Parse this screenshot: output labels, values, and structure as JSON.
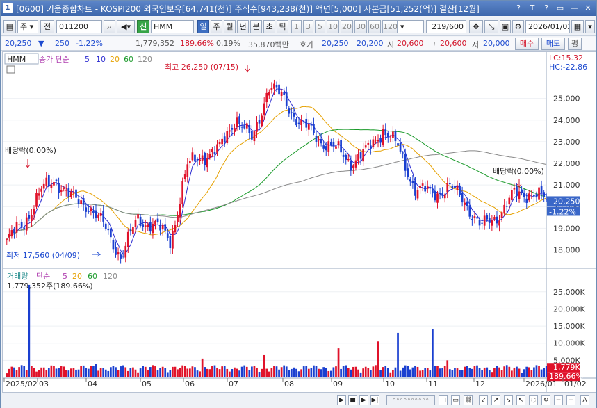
{
  "window": {
    "badge": "1",
    "title": "[0600] 키움종합차트 - KOSPI200 외국인보유[64,741(천)] 주식수[943,238(천)] 액면[5,000] 자본금[51,252(억)] 결산[12월]",
    "controls": [
      "?",
      "T",
      "?",
      "▭",
      "—",
      "✕"
    ]
  },
  "toolbar": {
    "period_select": "주",
    "prev_label": "전",
    "code": "011200",
    "sin_label": "신",
    "stock_name": "HMM",
    "periods": [
      "일",
      "주",
      "월",
      "년",
      "분",
      "초",
      "틱"
    ],
    "active_period": "일",
    "minutes": [
      "1",
      "3",
      "5",
      "10",
      "20",
      "30",
      "60",
      "120"
    ],
    "count": "219",
    "count_max": "/600",
    "date": "2026/01/02"
  },
  "quote": {
    "price": "20,250",
    "arrow": "▼",
    "change": "250",
    "change_pct": "-1.22%",
    "volume": "1,779,352",
    "volume_ratio": "189.66%",
    "turnover": "0.19%",
    "amount": "35,870백만",
    "hoga_label": "호가",
    "ask": "20,250",
    "bid": "20,200",
    "open_label": "시",
    "open": "20,600",
    "high_label": "고",
    "high": "20,600",
    "low_label": "저",
    "low": "20,000",
    "buy_btn": "매수",
    "sell_btn": "매도",
    "eval_btn": "평"
  },
  "price_panel": {
    "legend_name": "HMM",
    "legend_ma": "종가 단순",
    "ma_periods": [
      "5",
      "10",
      "20",
      "60",
      "120"
    ],
    "ma_colors": [
      "#2a2ad0",
      "#2a2ad0",
      "#e6a100",
      "#1a9a2a",
      "#888888"
    ],
    "lc_label": "LC:15.32",
    "hc_label": "HC:-22.86",
    "high_annot": "최고 26,250 (07/15)",
    "low_annot": "최저 17,560 (04/09)",
    "div_left": "배당락(0.00%)",
    "div_right": "배당락(0.00%)",
    "last_price": "20,250",
    "last_pct": "-1.22%"
  },
  "volume_panel": {
    "legend_name": "거래량",
    "legend_ma": "단순",
    "ma_periods": [
      "5",
      "20",
      "60",
      "120"
    ],
    "last_vol": "1,779,352주(189.66%)",
    "last_vol_tag": "1,779K",
    "last_pct_tag": "189.66%",
    "y_ticks": [
      "25,000K",
      "20,000K",
      "15,000K",
      "10,000K",
      "5,000K"
    ]
  },
  "x_axis": [
    "2025/02",
    "03",
    "04",
    "05",
    "06",
    "07",
    "08",
    "09",
    "10",
    "11",
    "12",
    "2026/01",
    "01/02"
  ],
  "chart_data": {
    "type": "candlestick",
    "ylim": [
      17500,
      26500
    ],
    "y_ticks": [
      18000,
      19000,
      20000,
      21000,
      22000,
      23000,
      24000,
      25000
    ],
    "months": [
      "2025/02",
      "03",
      "04",
      "05",
      "06",
      "07",
      "08",
      "09",
      "10",
      "11",
      "12",
      "2026/01"
    ],
    "close_path_months": [
      {
        "m": "2025/02",
        "v": [
          18400,
          19200,
          20600
        ]
      },
      {
        "m": "03",
        "v": [
          21300,
          20300,
          20100
        ]
      },
      {
        "m": "04",
        "v": [
          19000,
          17700,
          19400
        ]
      },
      {
        "m": "05",
        "v": [
          19200,
          18400,
          21800
        ]
      },
      {
        "m": "06",
        "v": [
          22400,
          22600,
          24200
        ]
      },
      {
        "m": "07",
        "v": [
          23000,
          25600,
          24900
        ]
      },
      {
        "m": "08",
        "v": [
          23800,
          23200,
          22700
        ]
      },
      {
        "m": "09",
        "v": [
          22100,
          22500,
          23600
        ]
      },
      {
        "m": "10",
        "v": [
          22600,
          20800,
          20600
        ]
      },
      {
        "m": "11",
        "v": [
          20900,
          20300,
          19000
        ]
      },
      {
        "m": "12",
        "v": [
          19600,
          20500,
          20700
        ]
      },
      {
        "m": "2026/01",
        "v": [
          20250
        ]
      }
    ],
    "high": {
      "value": 26250,
      "date": "07/15"
    },
    "low": {
      "value": 17560,
      "date": "04/09"
    },
    "volume_ylim": [
      0,
      28000
    ],
    "volume_units": "K"
  }
}
